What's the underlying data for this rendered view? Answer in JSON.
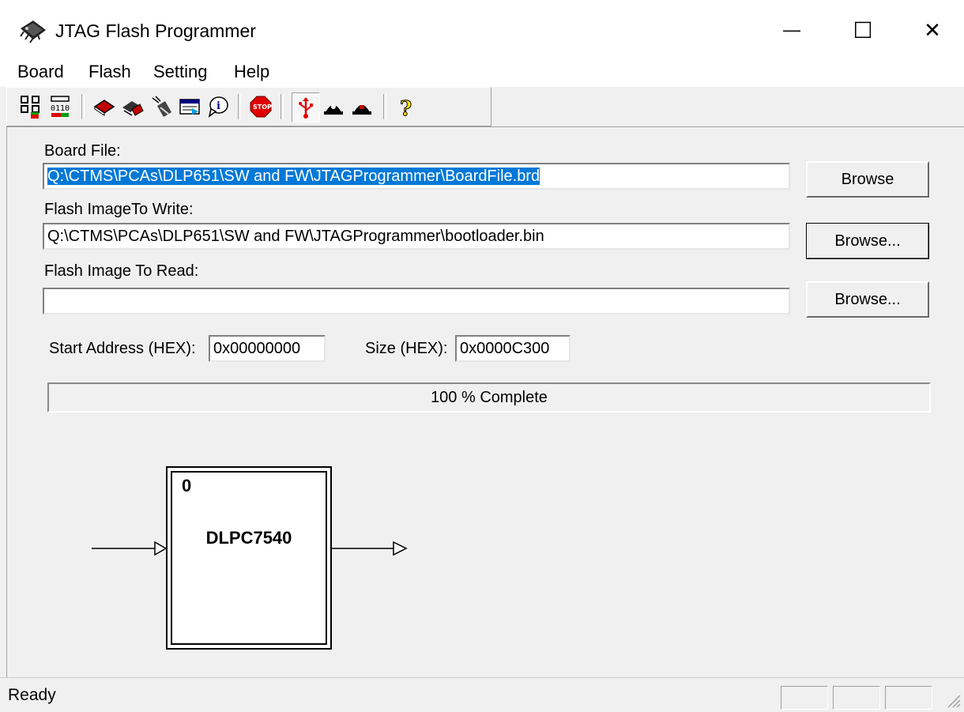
{
  "window": {
    "title": "JTAG Flash Programmer",
    "minimize_glyph": "—",
    "maximize_glyph": "☐",
    "close_glyph": "✕"
  },
  "menu": {
    "items": [
      "Board",
      "Flash",
      "Setting",
      "Help"
    ]
  },
  "toolbar": {
    "buttons": [
      "jtag-chain-icon",
      "binary-data-icon",
      "book-icon",
      "eraser-icon",
      "program-icon",
      "window-icon",
      "info-icon",
      "stop-icon",
      "usb-icon",
      "cable-icon",
      "cable-alt-icon",
      "help-icon"
    ],
    "pressed": "usb-icon"
  },
  "board_file": {
    "label": "Board File:",
    "value": "Q:\\CTMS\\PCAs\\DLP651\\SW and FW\\JTAGProgrammer\\BoardFile.brd",
    "button": "Browse"
  },
  "flash_write": {
    "label": "Flash ImageTo Write:",
    "value": "Q:\\CTMS\\PCAs\\DLP651\\SW and FW\\JTAGProgrammer\\bootloader.bin",
    "button": "Browse..."
  },
  "flash_read": {
    "label": "Flash Image To Read:",
    "value": "",
    "button": "Browse..."
  },
  "start_address": {
    "label": "Start Address (HEX):",
    "value": "0x00000000"
  },
  "size": {
    "label": "Size (HEX):",
    "value": "0x0000C300"
  },
  "progress": {
    "percent": 100,
    "text": "100 % Complete"
  },
  "chain": {
    "device_index": "0",
    "device_name": "DLPC7540"
  },
  "status": {
    "text": "Ready"
  }
}
